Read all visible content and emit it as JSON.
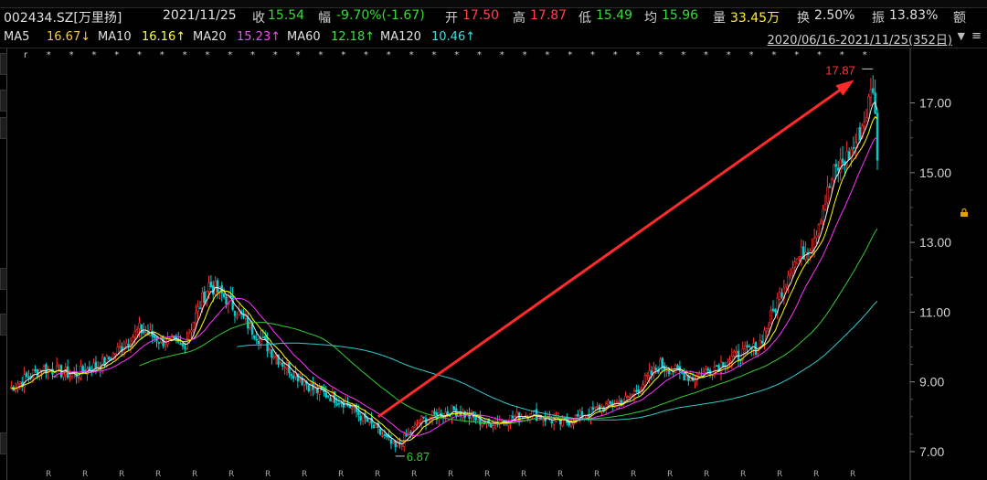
{
  "quote": {
    "code_name": "002434.SZ[万里扬]",
    "date": "2021/11/25",
    "close_label": "收",
    "close": "15.54",
    "change_label": "幅",
    "change": "-9.70%(-1.67)",
    "open_label": "开",
    "open": "17.50",
    "high_label": "高",
    "high": "17.87",
    "low_label": "低",
    "low": "15.49",
    "avg_label": "均",
    "avg": "15.96",
    "vol_label": "量",
    "vol": "33.45万",
    "turnover_label": "换",
    "turnover": "2.50%",
    "amplitude_label": "振",
    "amplitude": "13.83%",
    "amount_label": "额"
  },
  "ma_legend": [
    {
      "label": "MA5",
      "value": "16.67",
      "arrow": "↓",
      "color": "#f0f0f0"
    },
    {
      "label": "MA10",
      "value": "16.16",
      "arrow": "↑",
      "color": "#ffff00"
    },
    {
      "label": "MA20",
      "value": "15.23",
      "arrow": "↑",
      "color": "#ff33ff"
    },
    {
      "label": "MA60",
      "value": "12.18",
      "arrow": "↑",
      "color": "#33cc33"
    },
    {
      "label": "MA120",
      "value": "10.46",
      "arrow": "↑",
      "color": "#33cccc"
    }
  ],
  "date_range": "2020/06/16-2021/11/25(352日)",
  "icons": {
    "dropdown": "triangle-down-icon",
    "settings": "lock-icon"
  },
  "colors": {
    "up": "#ff3333",
    "down": "#00d0d0",
    "bg": "#000000",
    "arrow": "#ff2a2a",
    "high_label": "#ff3333",
    "low_label": "#33cc33"
  },
  "chart_data": {
    "type": "candlestick",
    "y_ticks": [
      "17.00",
      "15.00",
      "13.00",
      "11.00",
      "9.00",
      "7.00"
    ],
    "ylim": [
      6.5,
      18.3
    ],
    "marks": {
      "high": "17.87",
      "low": "6.87"
    },
    "annotation": {
      "type": "arrow",
      "from_value": 8.0,
      "to_value": 17.6,
      "color": "#ff2a2a"
    },
    "markers_top": [
      "r",
      "*",
      "*",
      "*",
      "*",
      "*",
      "*",
      "*",
      "*",
      "*",
      "*",
      "*",
      "*",
      "*",
      "*",
      "*",
      "*",
      "*",
      "*",
      "*",
      "*",
      "*",
      "*",
      "*",
      "*",
      "*",
      "*",
      "*",
      "*",
      "*",
      "*",
      "*",
      "*",
      "*",
      "*",
      "*",
      "*",
      "*"
    ],
    "markers_bottom": [
      "R",
      "R",
      "R",
      "R",
      "R",
      "R",
      "R",
      "R",
      "R",
      "R",
      "R",
      "R",
      "R",
      "R",
      "R",
      "R",
      "R",
      "R",
      "R",
      "R",
      "R",
      "R",
      "R"
    ],
    "trend_keypoints": [
      [
        0,
        8.8
      ],
      [
        15,
        9.4
      ],
      [
        30,
        9.2
      ],
      [
        45,
        9.6
      ],
      [
        60,
        10.5
      ],
      [
        70,
        10.2
      ],
      [
        80,
        10.0
      ],
      [
        92,
        11.8
      ],
      [
        100,
        11.4
      ],
      [
        112,
        10.5
      ],
      [
        125,
        9.6
      ],
      [
        140,
        8.8
      ],
      [
        155,
        8.4
      ],
      [
        168,
        7.7
      ],
      [
        178,
        7.1
      ],
      [
        190,
        7.9
      ],
      [
        205,
        8.2
      ],
      [
        220,
        7.8
      ],
      [
        240,
        8.1
      ],
      [
        255,
        7.8
      ],
      [
        270,
        8.2
      ],
      [
        285,
        8.5
      ],
      [
        300,
        9.5
      ],
      [
        315,
        9.1
      ],
      [
        330,
        9.6
      ],
      [
        345,
        10.0
      ],
      [
        352,
        11.0
      ],
      [
        360,
        12.3
      ],
      [
        370,
        13.0
      ],
      [
        380,
        15.0
      ],
      [
        388,
        15.6
      ],
      [
        394,
        16.5
      ],
      [
        398,
        17.5
      ],
      [
        400,
        15.6
      ]
    ]
  }
}
